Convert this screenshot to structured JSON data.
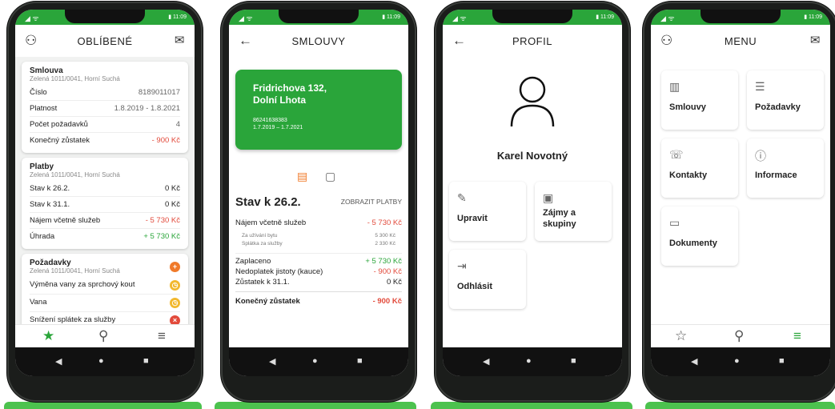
{
  "status": {
    "time": "11:09"
  },
  "p1": {
    "title": "OBLÍBENÉ",
    "smlouva": {
      "title": "Smlouva",
      "address": "Zelená 1011/0041, Horní Suchá",
      "rows": [
        {
          "label": "Číslo",
          "value": "8189011017"
        },
        {
          "label": "Platnost",
          "value": "1.8.2019 - 1.8.2021"
        },
        {
          "label": "Počet požadavků",
          "value": "4"
        },
        {
          "label": "Konečný zůstatek",
          "value": "- 900 Kč"
        }
      ]
    },
    "platby": {
      "title": "Platby",
      "address": "Zelená 1011/0041, Horní Suchá",
      "rows": [
        {
          "label": "Stav k 26.2.",
          "value": "0 Kč"
        },
        {
          "label": "Stav k 31.1.",
          "value": "0 Kč"
        },
        {
          "label": "Nájem včetně služeb",
          "value": "- 5 730 Kč"
        },
        {
          "label": "Úhrada",
          "value": "+ 5 730 Kč"
        }
      ]
    },
    "pozadavky": {
      "title": "Požadavky",
      "address": "Zelená 1011/0041, Horní Suchá",
      "items": [
        "Výměna vany za sprchový kout",
        "Vana",
        "Snížení splátek za služby"
      ]
    }
  },
  "p2": {
    "title": "SMLOUVY",
    "card": {
      "line1": "Fridrichova 132,",
      "line2": "Dolní Lhota",
      "number": "86241638383",
      "period": "1.7.2019 – 1.7.2021"
    },
    "stav_title": "Stav k 26.2.",
    "link": "ZOBRAZIT PLATBY",
    "rows": [
      {
        "label": "Nájem včetně služeb",
        "value": "- 5 730 Kč"
      },
      {
        "label": "Za užívání bytu",
        "value": "5 300 Kč"
      },
      {
        "label": "Splátka za služby",
        "value": "2 330 Kč"
      },
      {
        "label": "Zaplaceno",
        "value": "+ 5 730 Kč"
      },
      {
        "label": "Nedoplatek jistoty (kauce)",
        "value": "- 900 Kč"
      },
      {
        "label": "Zůstatek k 31.1.",
        "value": "0 Kč"
      },
      {
        "label": "Konečný zůstatek",
        "value": "- 900 Kč"
      }
    ]
  },
  "p3": {
    "title": "PROFIL",
    "name": "Karel Novotný",
    "tiles": [
      "Upravit",
      "Zájmy a skupiny",
      "Odhlásit"
    ]
  },
  "p4": {
    "title": "MENU",
    "tiles": [
      "Smlouvy",
      "Požadavky",
      "Kontakty",
      "Informace",
      "Dokumenty"
    ]
  },
  "colors": {
    "accent": "#2aa53a",
    "negative": "#e24a3b",
    "warning": "#f2b82e",
    "orange": "#f07a2a"
  }
}
